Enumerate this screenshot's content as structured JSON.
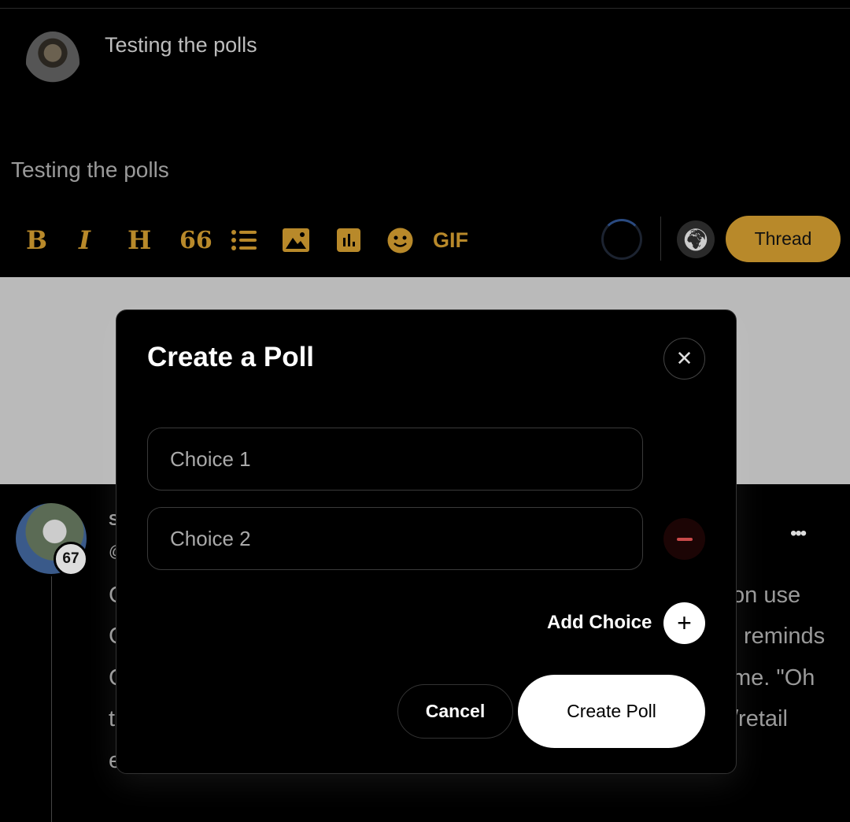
{
  "post": {
    "title": "Testing the polls",
    "body": "Testing the polls"
  },
  "toolbar": {
    "bold": "B",
    "italic": "I",
    "heading": "H",
    "quote": "66",
    "gif": "GIF",
    "thread_label": "Thread"
  },
  "feed": {
    "badge": "67",
    "fragments": [
      "S",
      "@",
      "C",
      "C",
      "C",
      "t",
      "e"
    ],
    "right_fragments": [
      "on use",
      "reminds",
      "me. \"Oh",
      "/retail"
    ],
    "more": "•••"
  },
  "modal": {
    "title": "Create a Poll",
    "choices": [
      {
        "placeholder": "Choice 1"
      },
      {
        "placeholder": "Choice 2"
      }
    ],
    "add_choice": "Add Choice",
    "cancel": "Cancel",
    "create": "Create Poll"
  },
  "colors": {
    "accent": "#b8892a",
    "danger": "#c94a4a"
  }
}
